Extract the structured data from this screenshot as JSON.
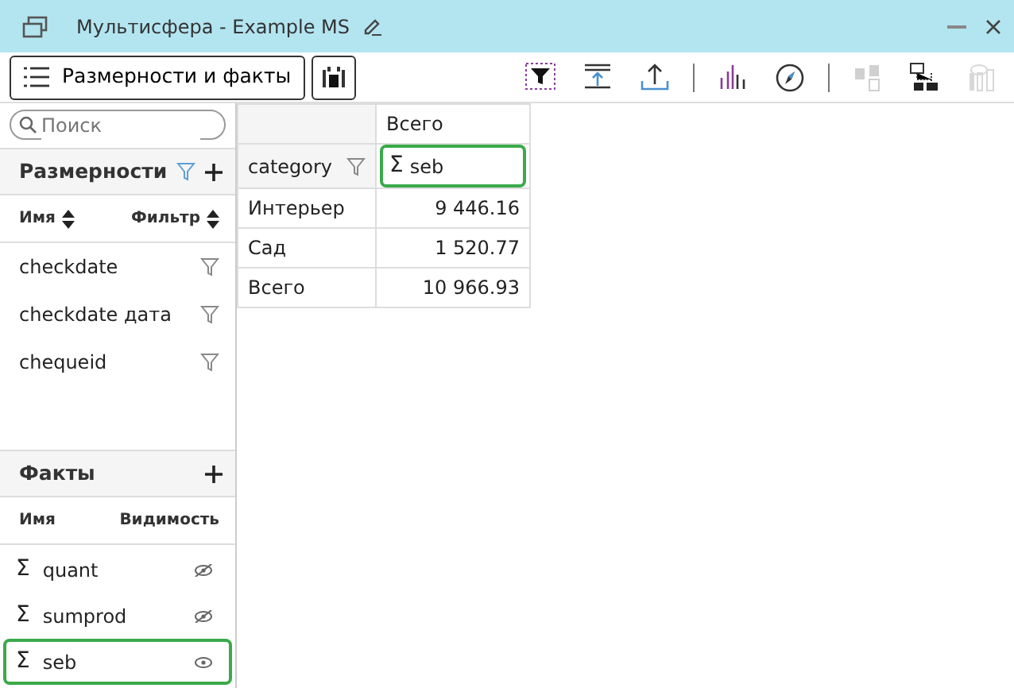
{
  "window": {
    "title": "Мультисфера - Example MS"
  },
  "toolbar": {
    "main_button": "Размерности и факты",
    "tools": [
      {
        "kind": "filter",
        "disabled": false
      },
      {
        "kind": "export",
        "disabled": false
      },
      {
        "kind": "upload",
        "disabled": false
      },
      {
        "kind": "separator"
      },
      {
        "kind": "chart",
        "disabled": false
      },
      {
        "kind": "compass",
        "disabled": false
      },
      {
        "kind": "separator"
      },
      {
        "kind": "copy",
        "disabled": true
      },
      {
        "kind": "tree",
        "disabled": false
      },
      {
        "kind": "columns",
        "disabled": true
      }
    ]
  },
  "sidebar": {
    "search": {
      "placeholder": "Поиск"
    },
    "dimensions": {
      "title": "Размерности",
      "columns": [
        "Имя",
        "Фильтр"
      ],
      "items": [
        {
          "name": "checkdate"
        },
        {
          "name": "checkdate дата"
        },
        {
          "name": "chequeid"
        }
      ]
    },
    "facts": {
      "title": "Факты",
      "columns": [
        "Имя",
        "Видимость"
      ],
      "items": [
        {
          "sigma": "Σ",
          "name": "quant",
          "visible": false,
          "selected": false
        },
        {
          "sigma": "Σ",
          "name": "sumprod",
          "visible": false,
          "selected": false
        },
        {
          "sigma": "Σ",
          "name": "seb",
          "visible": true,
          "selected": true
        }
      ]
    }
  },
  "table": {
    "column_header": "Всего",
    "row_dimension": "category",
    "measure": {
      "sigma": "Σ",
      "name": "seb",
      "selected": true
    },
    "rows": [
      {
        "label": "Интерьер",
        "value": "9 446.16"
      },
      {
        "label": "Сад",
        "value": "1 520.77"
      },
      {
        "label": "Всего",
        "value": "10 966.93"
      }
    ]
  }
}
